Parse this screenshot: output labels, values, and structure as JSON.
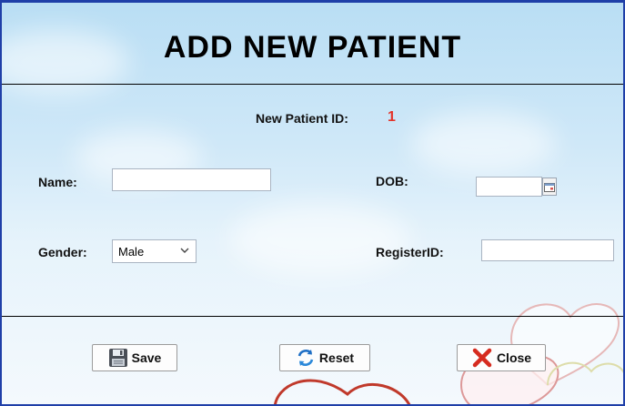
{
  "form": {
    "title": "ADD NEW PATIENT",
    "patient_id_label": "New Patient ID:",
    "patient_id_value": "1",
    "name_label": "Name:",
    "name_value": "",
    "dob_label": "DOB:",
    "dob_value": "",
    "gender_label": "Gender:",
    "gender_selected": "Male",
    "register_id_label": "RegisterID:",
    "register_id_value": ""
  },
  "buttons": {
    "save_label": "Save",
    "reset_label": "Reset",
    "close_label": "Close"
  },
  "colors": {
    "patient_id": "#e3342a",
    "window_border": "#1f3fa8"
  },
  "icons": {
    "save": "floppy-disk-icon",
    "reset": "refresh-icon",
    "close": "red-x-icon",
    "calendar": "calendar-icon",
    "dropdown": "chevron-down-icon"
  }
}
